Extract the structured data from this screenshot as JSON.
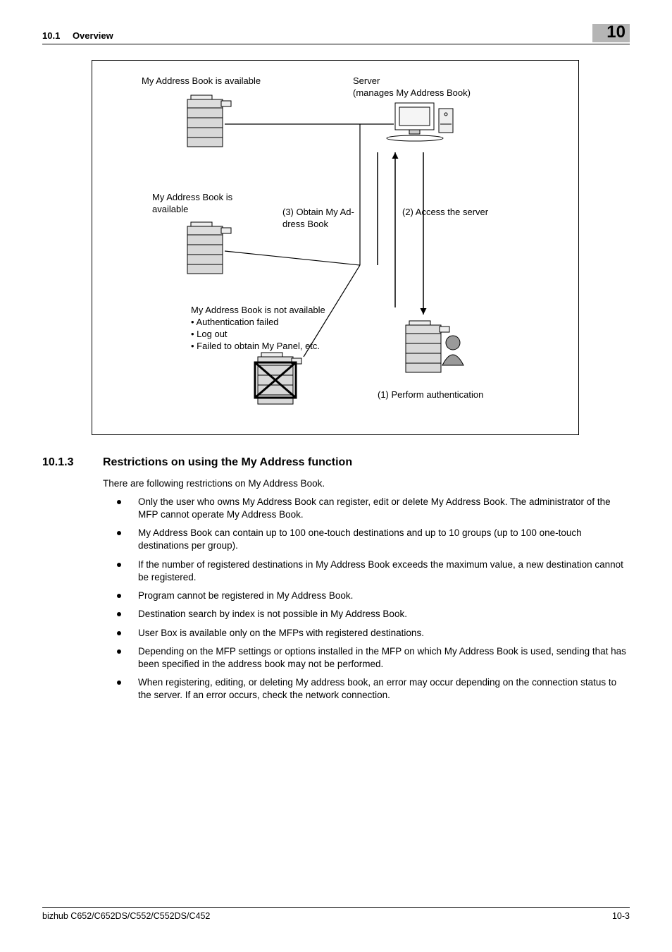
{
  "header": {
    "section_number": "10.1",
    "section_title": "Overview",
    "chapter": "10"
  },
  "diagram": {
    "labels": {
      "top_left": "My Address Book is available",
      "top_right_1": "Server",
      "top_right_2": "(manages My Address Book)",
      "mid_left_1": "My Address Book is",
      "mid_left_2": "available",
      "step3_1": "(3) Obtain My Ad-",
      "step3_2": "dress Book",
      "step2": "(2) Access the server",
      "not_avail": "My Address Book is not available",
      "bullet1": "• Authentication failed",
      "bullet2": "• Log out",
      "bullet3": "• Failed to obtain My Panel, etc.",
      "step1": "(1) Perform authentication"
    }
  },
  "section": {
    "number": "10.1.3",
    "title": "Restrictions on using the My Address function",
    "intro": "There are following restrictions on My Address Book.",
    "items": [
      "Only the user who owns My Address Book can register, edit or delete My Address Book. The administrator of the MFP cannot operate My Address Book.",
      "My Address Book can contain up to 100 one-touch destinations and up to 10 groups (up to 100 one-touch destinations per group).",
      "If the number of registered destinations in My Address Book exceeds the maximum value, a new destination cannot be registered.",
      "Program cannot be registered in My Address Book.",
      "Destination search by index is not possible in My Address Book.",
      "User Box is available only on the MFPs with registered destinations.",
      "Depending on the MFP settings or options installed in the MFP on which My Address Book is used, sending that has been specified in the address book may not be performed.",
      "When registering, editing, or deleting My address book, an error may occur depending on the connection status to the server. If an error occurs, check the network connection."
    ]
  },
  "footer": {
    "left": "bizhub C652/C652DS/C552/C552DS/C452",
    "right": "10-3"
  }
}
